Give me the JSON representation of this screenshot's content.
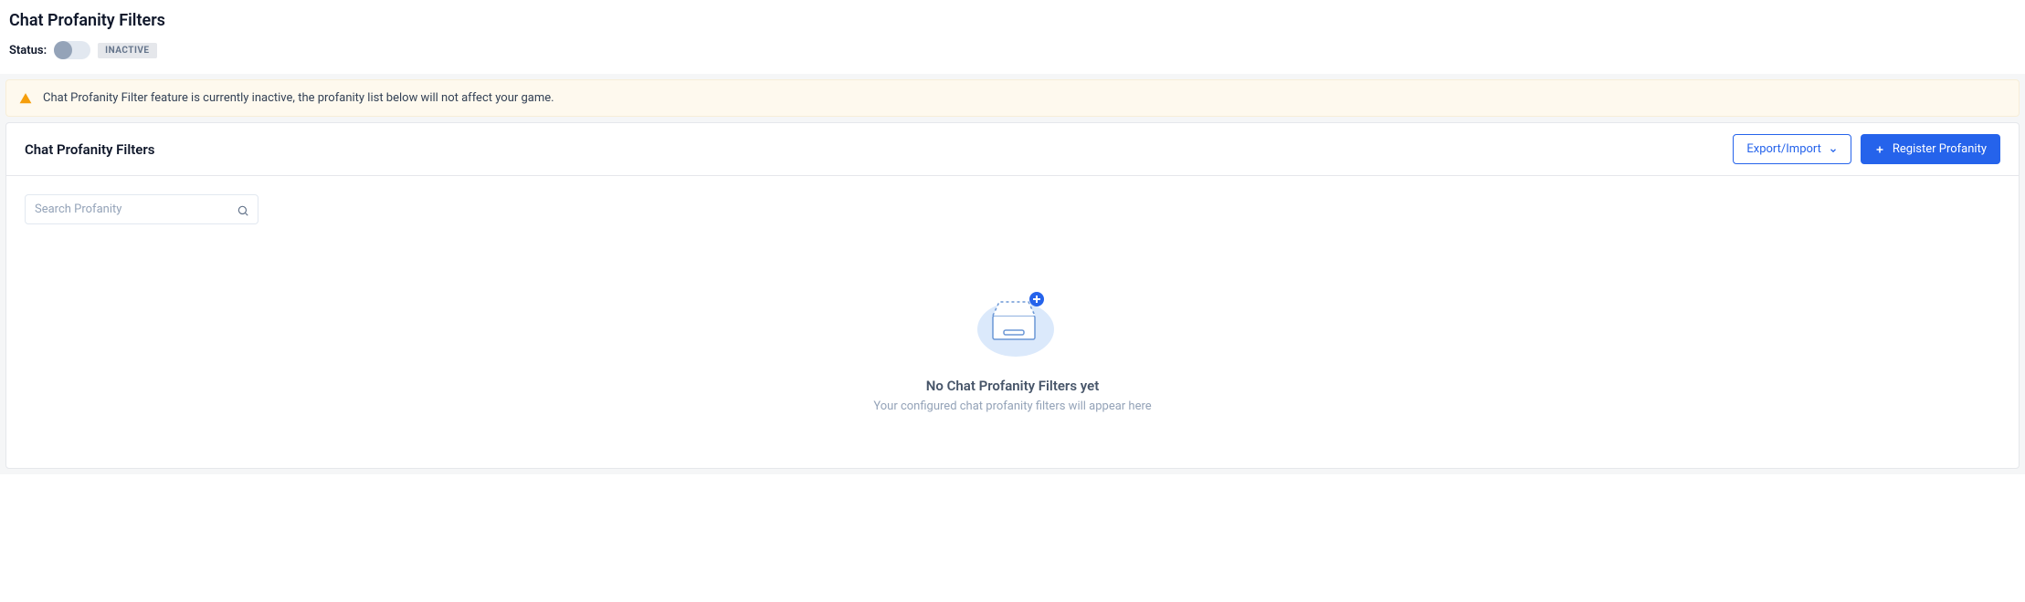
{
  "header": {
    "title": "Chat Profanity Filters",
    "status_label": "Status:",
    "status_badge": "INACTIVE"
  },
  "alert": {
    "message": "Chat Profanity Filter feature is currently inactive, the profanity list below will not affect your game."
  },
  "panel": {
    "title": "Chat Profanity Filters",
    "export_import_label": "Export/Import",
    "register_label": "Register Profanity"
  },
  "search": {
    "placeholder": "Search Profanity"
  },
  "empty_state": {
    "title": "No Chat Profanity Filters yet",
    "subtitle": "Your configured chat profanity filters will appear here"
  }
}
